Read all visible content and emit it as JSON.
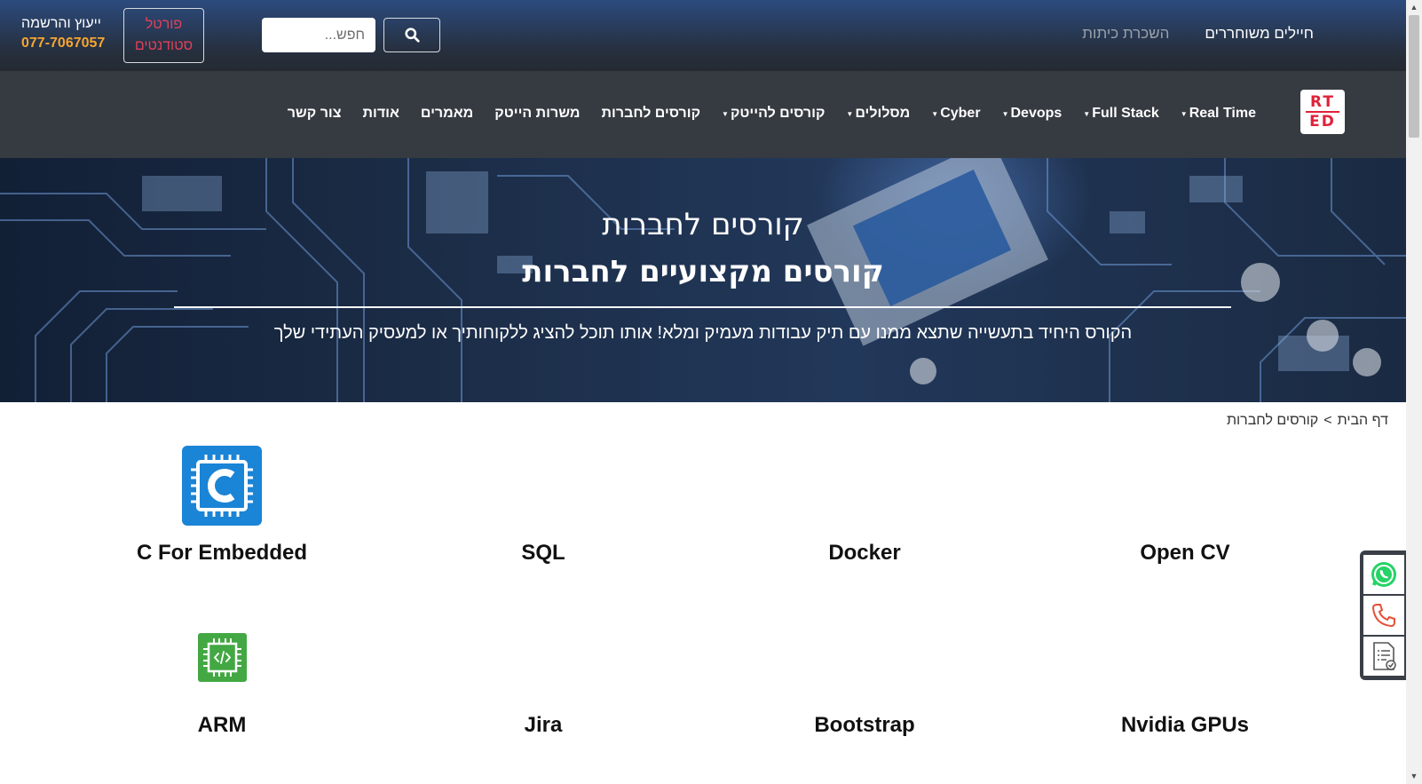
{
  "header": {
    "links": [
      {
        "label": "חיילים משוחררים"
      },
      {
        "label": "השכרת כיתות"
      }
    ],
    "search": {
      "placeholder": "חפש..."
    },
    "portal_label_line1": "פורטל",
    "portal_label_line2": "סטודנטים",
    "contact_label": "ייעוץ והרשמה",
    "contact_phone": "077-7067057"
  },
  "logo": {
    "line1": "RT",
    "line2": "ED"
  },
  "nav": {
    "items": [
      {
        "label": "Real Time",
        "dropdown": true
      },
      {
        "label": "Full Stack",
        "dropdown": true
      },
      {
        "label": "Devops",
        "dropdown": true
      },
      {
        "label": "Cyber",
        "dropdown": true
      },
      {
        "label": "מסלולים",
        "dropdown": true
      },
      {
        "label": "קורסים להייטק",
        "dropdown": true
      },
      {
        "label": "קורסים לחברות",
        "dropdown": false
      },
      {
        "label": "משרות הייטק",
        "dropdown": false
      },
      {
        "label": "מאמרים",
        "dropdown": false
      },
      {
        "label": "אודות",
        "dropdown": false
      },
      {
        "label": "צור קשר",
        "dropdown": false
      }
    ]
  },
  "hero": {
    "title": "קורסים לחברות",
    "subtitle": "קורסים מקצועיים לחברות",
    "description": "הקורס היחיד בתעשייה שתצא ממנו עם תיק עבודות מעמיק ומלא! אותו תוכל להציג ללקוחותיך או למעסיק העתידי שלך"
  },
  "breadcrumb": {
    "home": "דף הבית",
    "separator": ">",
    "current": "קורסים לחברות"
  },
  "courses": [
    {
      "title": "C For Embedded",
      "icon": "c-chip-icon"
    },
    {
      "title": "SQL"
    },
    {
      "title": "Docker"
    },
    {
      "title": "Open CV"
    },
    {
      "title": "ARM",
      "icon": "code-chip-icon"
    },
    {
      "title": "Jira"
    },
    {
      "title": "Bootstrap"
    },
    {
      "title": "Nvidia GPUs"
    }
  ],
  "colors": {
    "accent_orange": "#f7a531",
    "portal_red": "#e0405a",
    "nav_bg": "#363a41",
    "c_icon_blue": "#1a84d6",
    "arm_icon_green": "#43a843",
    "whatsapp_green": "#25d366",
    "phone_red": "#e4513a"
  }
}
